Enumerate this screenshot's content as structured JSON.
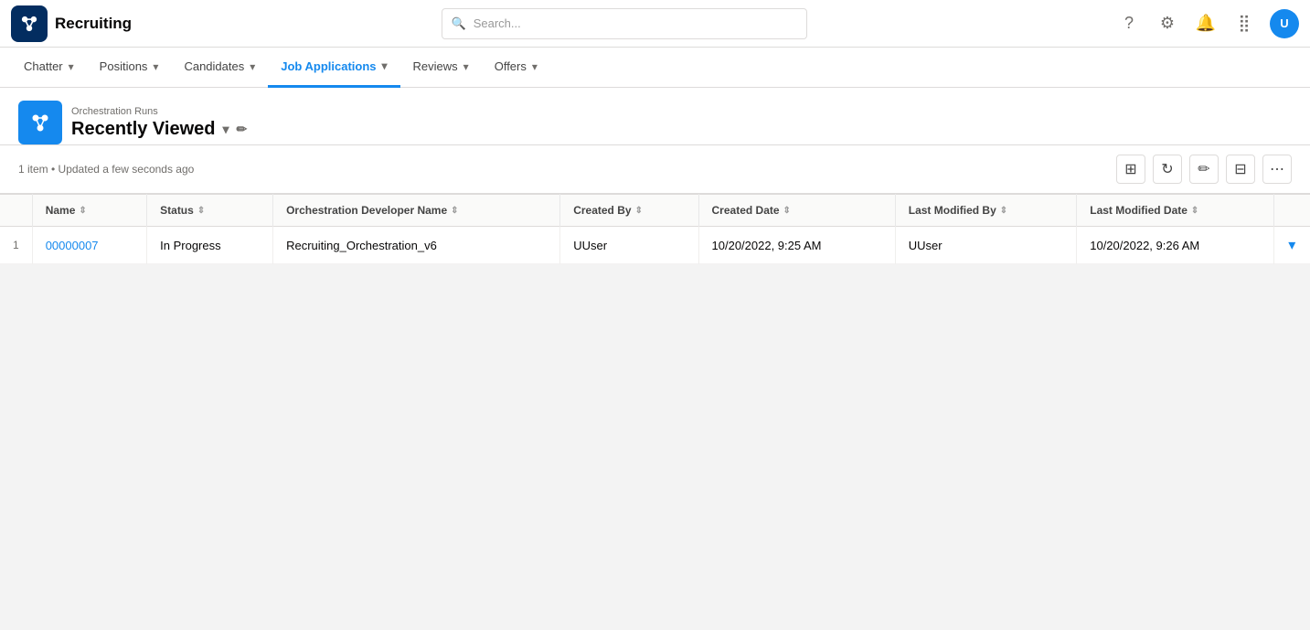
{
  "app": {
    "title": "Recruiting",
    "logo_alt": "recruiting-logo"
  },
  "search": {
    "placeholder": "Search..."
  },
  "nav": {
    "tabs": [
      {
        "label": "Chatter",
        "active": false
      },
      {
        "label": "Positions",
        "active": false
      },
      {
        "label": "Candidates",
        "active": false
      },
      {
        "label": "Job Applications",
        "active": true
      },
      {
        "label": "Reviews",
        "active": false
      },
      {
        "label": "Offers",
        "active": false
      }
    ]
  },
  "page_header": {
    "subtitle": "Orchestration Runs",
    "title": "Recently Viewed",
    "title_icon": "▾"
  },
  "toolbar": {
    "meta": "1 item • Updated a few seconds ago"
  },
  "table": {
    "columns": [
      {
        "key": "row_num",
        "label": ""
      },
      {
        "key": "name",
        "label": "Name"
      },
      {
        "key": "status",
        "label": "Status"
      },
      {
        "key": "orchestration_developer_name",
        "label": "Orchestration Developer Name"
      },
      {
        "key": "created_by",
        "label": "Created By"
      },
      {
        "key": "created_date",
        "label": "Created Date"
      },
      {
        "key": "last_modified_by",
        "label": "Last Modified By"
      },
      {
        "key": "last_modified_date",
        "label": "Last Modified Date"
      },
      {
        "key": "action",
        "label": ""
      }
    ],
    "rows": [
      {
        "row_num": "1",
        "name": "00000007",
        "name_link": "#",
        "status": "In Progress",
        "orchestration_developer_name": "Recruiting_Orchestration_v6",
        "created_by": "UUser",
        "created_date": "10/20/2022, 9:25 AM",
        "last_modified_by": "UUser",
        "last_modified_date": "10/20/2022, 9:26 AM"
      }
    ]
  },
  "icons": {
    "search": "🔍",
    "question": "❓",
    "settings": "⚙",
    "setup": "⚙",
    "notification": "🔔",
    "apps": "⣿",
    "chevron_down": "▾",
    "sort": "⇕",
    "refresh": "↻",
    "edit": "✏",
    "filter": "⊟",
    "columns": "⊞",
    "action_arrow": "▾",
    "object": "⚡"
  },
  "colors": {
    "brand": "#1589ee",
    "brand_dark": "#032d60",
    "text_primary": "#080707",
    "text_secondary": "#706e6b",
    "border": "#dddbda",
    "bg_nav": "#fff",
    "active_tab_border": "#1589ee"
  }
}
